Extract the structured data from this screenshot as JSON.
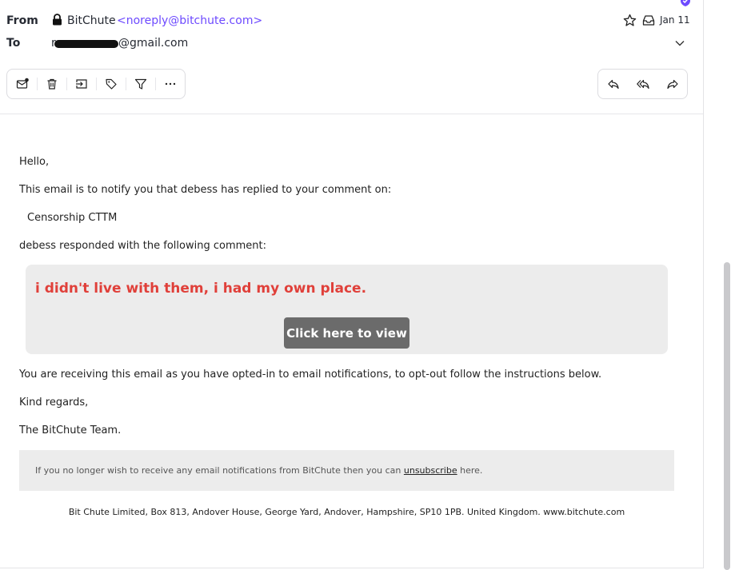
{
  "header": {
    "from_label": "From",
    "to_label": "To",
    "sender_name": "BitChute",
    "sender_email": "<noreply@bitchute.com>",
    "recipient_prefix": "r",
    "recipient_domain": "@gmail.com",
    "date": "Jan 11"
  },
  "icons": {
    "lock": "lock-icon",
    "star": "star-icon",
    "inbox": "inbox-icon",
    "expand": "chevron-down-icon"
  },
  "toolbar": {
    "left": [
      "mark-unread-icon",
      "trash-icon",
      "move-to-icon",
      "label-icon",
      "filter-icon",
      "more-icon"
    ],
    "right": [
      "reply-icon",
      "reply-all-icon",
      "forward-icon"
    ]
  },
  "email": {
    "greeting": "Hello,",
    "notice": "This email is to notify you that debess has replied to your comment on:",
    "video_title": "Censorship CTTM",
    "response_intro": "debess responded with the following comment:",
    "comment": "i didn't live with them, i had my own place.",
    "button_label": "Click here to view",
    "optin_notice": "You are receiving this email as you have opted-in to email notifications, to opt-out follow the instructions below.",
    "regards": "Kind regards,",
    "signature": "The BitChute Team.",
    "footer_before": "If you no longer wish to receive any email notifications from BitChute then you can ",
    "footer_link": "unsubscribe",
    "footer_after": " here.",
    "address": "Bit Chute Limited, Box 813, Andover House, George Yard, Andover, Hampshire, SP10 1PB. United Kingdom. www.bitchute.com"
  },
  "colors": {
    "accent": "#6d4aff",
    "comment": "#e0403a",
    "button": "#6b6b6b",
    "panel": "#ececec"
  }
}
